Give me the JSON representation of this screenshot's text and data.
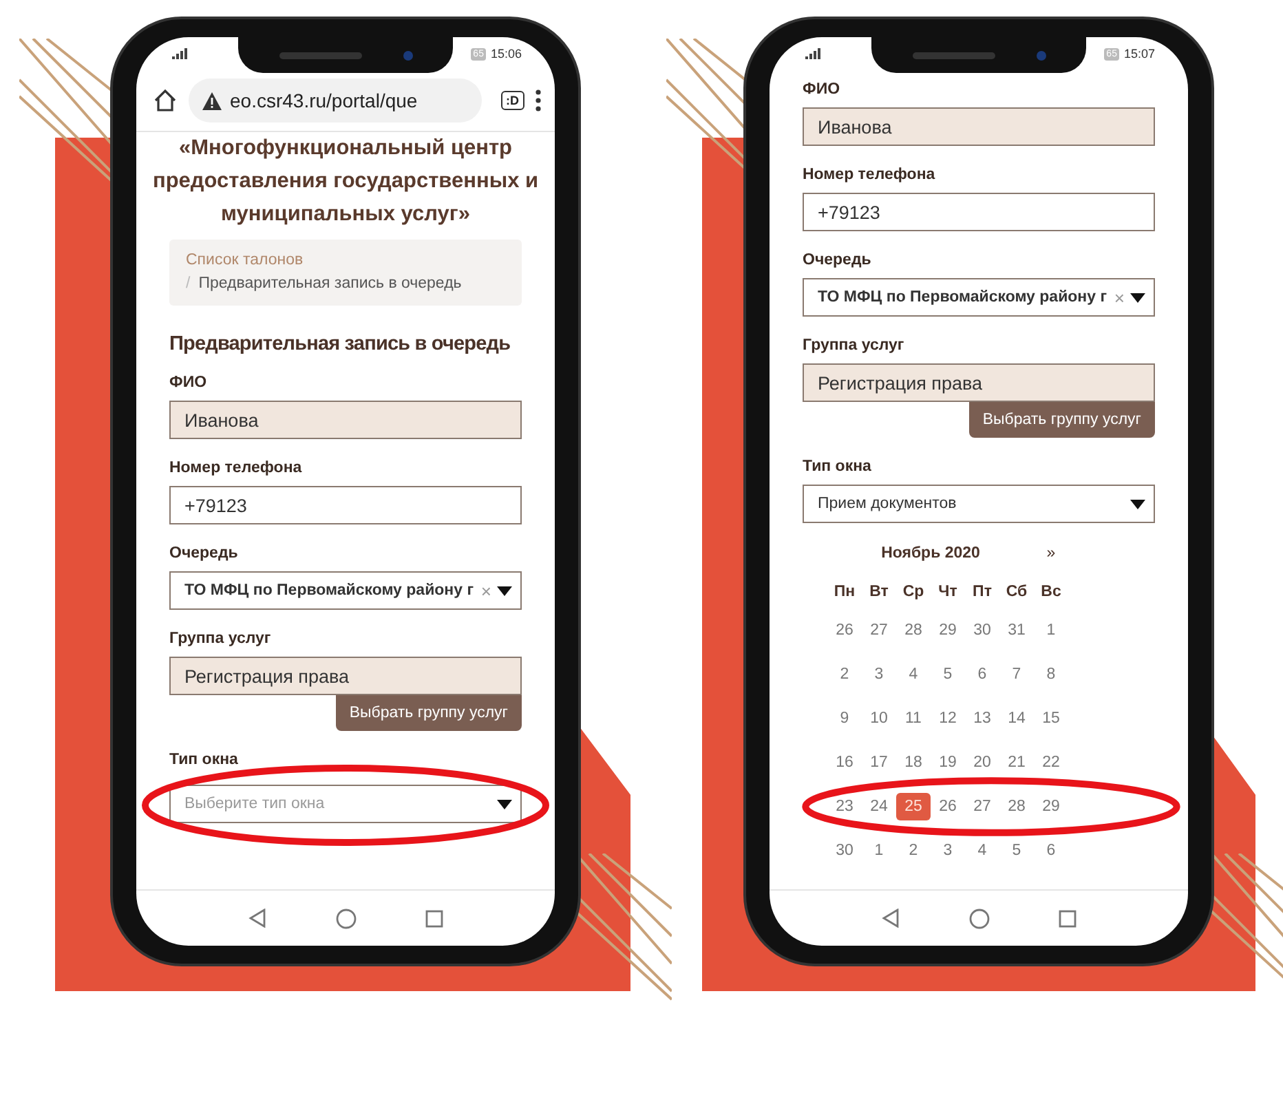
{
  "screens": [
    {
      "status_bar": {
        "battery": "65",
        "time": "15:06"
      },
      "browser": {
        "url": "eo.csr43.ru/portal/que",
        "tabs_label": ":D"
      },
      "title": "«Многофункциональный центр предоставления государственных и муниципальных услуг»",
      "breadcrumb": {
        "link": "Список талонов",
        "separator": "/",
        "current": "Предварительная запись в очередь"
      },
      "form_title": "Предварительная запись в очередь",
      "fields": [
        {
          "kind": "input",
          "label": "ФИО",
          "value": "Иванова",
          "readonly": true
        },
        {
          "kind": "input",
          "label": "Номер телефона",
          "value": "+79123",
          "readonly": false
        },
        {
          "kind": "select",
          "label": "Очередь",
          "value": "ТО МФЦ по Первомайскому району г",
          "clear": "×"
        },
        {
          "kind": "input",
          "label": "Группа услуг",
          "value": "Регистрация права",
          "readonly": true,
          "button": "Выбрать группу услуг"
        },
        {
          "kind": "select",
          "label": "Тип окна",
          "placeholder": "Выберите тип окна",
          "highlighted": true
        }
      ]
    },
    {
      "status_bar": {
        "battery": "65",
        "time": "15:07"
      },
      "fields": [
        {
          "kind": "input",
          "label": "ФИО",
          "value": "Иванова",
          "readonly": true
        },
        {
          "kind": "input",
          "label": "Номер телефона",
          "value": "+79123",
          "readonly": false
        },
        {
          "kind": "select",
          "label": "Очередь",
          "value": "ТО МФЦ по Первомайскому району г",
          "clear": "×"
        },
        {
          "kind": "input",
          "label": "Группа услуг",
          "value": "Регистрация права",
          "readonly": true,
          "button": "Выбрать группу услуг"
        },
        {
          "kind": "select",
          "label": "Тип окна",
          "value": "Прием документов"
        }
      ],
      "calendar": {
        "month": "Ноябрь 2020",
        "next": "»",
        "weekdays": [
          "Пн",
          "Вт",
          "Ср",
          "Чт",
          "Пт",
          "Сб",
          "Вс"
        ],
        "weeks": [
          {
            "highlighted": false,
            "days": [
              {
                "d": "26",
                "selected": false
              },
              {
                "d": "27",
                "selected": false
              },
              {
                "d": "28",
                "selected": false
              },
              {
                "d": "29",
                "selected": false
              },
              {
                "d": "30",
                "selected": false
              },
              {
                "d": "31",
                "selected": false
              },
              {
                "d": "1",
                "selected": false
              }
            ]
          },
          {
            "highlighted": false,
            "days": [
              {
                "d": "2",
                "selected": false
              },
              {
                "d": "3",
                "selected": false
              },
              {
                "d": "4",
                "selected": false
              },
              {
                "d": "5",
                "selected": false
              },
              {
                "d": "6",
                "selected": false
              },
              {
                "d": "7",
                "selected": false
              },
              {
                "d": "8",
                "selected": false
              }
            ]
          },
          {
            "highlighted": false,
            "days": [
              {
                "d": "9",
                "selected": false
              },
              {
                "d": "10",
                "selected": false
              },
              {
                "d": "11",
                "selected": false
              },
              {
                "d": "12",
                "selected": false
              },
              {
                "d": "13",
                "selected": false
              },
              {
                "d": "14",
                "selected": false
              },
              {
                "d": "15",
                "selected": false
              }
            ]
          },
          {
            "highlighted": false,
            "days": [
              {
                "d": "16",
                "selected": false
              },
              {
                "d": "17",
                "selected": false
              },
              {
                "d": "18",
                "selected": false
              },
              {
                "d": "19",
                "selected": false
              },
              {
                "d": "20",
                "selected": false
              },
              {
                "d": "21",
                "selected": false
              },
              {
                "d": "22",
                "selected": false
              }
            ]
          },
          {
            "highlighted": true,
            "days": [
              {
                "d": "23",
                "selected": false
              },
              {
                "d": "24",
                "selected": false
              },
              {
                "d": "25",
                "selected": true
              },
              {
                "d": "26",
                "selected": false
              },
              {
                "d": "27",
                "selected": false
              },
              {
                "d": "28",
                "selected": false
              },
              {
                "d": "29",
                "selected": false
              }
            ]
          },
          {
            "highlighted": false,
            "days": [
              {
                "d": "30",
                "selected": false
              },
              {
                "d": "1",
                "selected": false
              },
              {
                "d": "2",
                "selected": false
              },
              {
                "d": "3",
                "selected": false
              },
              {
                "d": "4",
                "selected": false
              },
              {
                "d": "5",
                "selected": false
              },
              {
                "d": "6",
                "selected": false
              }
            ]
          }
        ]
      }
    }
  ]
}
